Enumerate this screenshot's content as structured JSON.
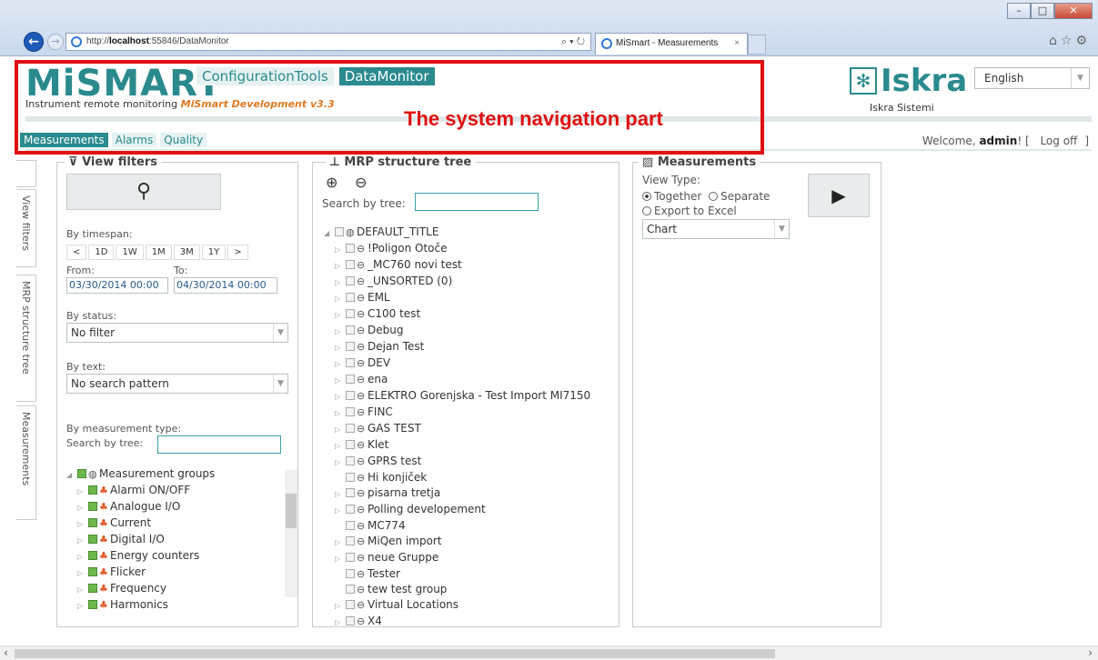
{
  "browser": {
    "url_prefix": "http://",
    "url_host": "localhost",
    "url_rest": ":55846/DataMonitor",
    "tab_title": "MiSmart - Measurements"
  },
  "header": {
    "logo": "MiSMART",
    "subtitle": "Instrument remote monitoring",
    "version": "MiSmart Development v3.3",
    "nav": [
      "ConfigurationTools",
      "DataMonitor"
    ],
    "subnav": [
      "Measurements",
      "Alarms",
      "Quality"
    ],
    "annotation": "The system navigation part",
    "brand": "Iskra",
    "brand_sub": "Iskra Sistemi",
    "language": "English",
    "welcome_prefix": "Welcome,",
    "user": "admin",
    "welcome_mid": "! [",
    "logout": "Log off",
    "welcome_suffix": "]"
  },
  "vtabs": [
    "View filters",
    "MRP structure tree",
    "Measurements"
  ],
  "filters": {
    "title": "View filters",
    "by_timespan": "By timespan:",
    "spans": [
      "<",
      "1D",
      "1W",
      "1M",
      "3M",
      "1Y",
      ">"
    ],
    "from_label": "From:",
    "to_label": "To:",
    "from": "03/30/2014 00:00",
    "to": "04/30/2014 00:00",
    "by_status": "By status:",
    "status": "No filter",
    "by_text": "By text:",
    "text": "No search pattern",
    "by_measurement_type": "By measurement type:",
    "search_by_tree": "Search by tree:",
    "tree_root": "Measurement groups",
    "tree_items": [
      "Alarmi ON/OFF",
      "Analogue I/O",
      "Current",
      "Digital I/O",
      "Energy counters",
      "Flicker",
      "Frequency",
      "Harmonics"
    ]
  },
  "mrp": {
    "title": "MRP structure tree",
    "search_by_tree": "Search by tree:",
    "root": "DEFAULT_TITLE",
    "items": [
      {
        "label": "!Poligon Otoče",
        "exp": true
      },
      {
        "label": "_MC760 novi test",
        "exp": true
      },
      {
        "label": "_UNSORTED (0)",
        "exp": true
      },
      {
        "label": "EML",
        "exp": true
      },
      {
        "label": "C100 test",
        "exp": true
      },
      {
        "label": "Debug",
        "exp": true
      },
      {
        "label": "Dejan Test",
        "exp": true
      },
      {
        "label": "DEV",
        "exp": true
      },
      {
        "label": "ena",
        "exp": true
      },
      {
        "label": "ELEKTRO Gorenjska - Test Import MI7150",
        "exp": true
      },
      {
        "label": "FINC",
        "exp": true
      },
      {
        "label": "GAS TEST",
        "exp": true
      },
      {
        "label": "Klet",
        "exp": true
      },
      {
        "label": "GPRS test",
        "exp": true
      },
      {
        "label": "Hi konjiček",
        "exp": false
      },
      {
        "label": "pisarna tretja",
        "exp": true
      },
      {
        "label": "Polling developement",
        "exp": true
      },
      {
        "label": "MC774",
        "exp": false
      },
      {
        "label": "MiQen import",
        "exp": true
      },
      {
        "label": "neue Gruppe",
        "exp": true
      },
      {
        "label": "Tester",
        "exp": false
      },
      {
        "label": "tew test group",
        "exp": false
      },
      {
        "label": "Virtual Locations",
        "exp": true
      },
      {
        "label": "X4",
        "exp": true
      }
    ]
  },
  "measurements": {
    "title": "Measurements",
    "view_type": "View Type:",
    "together": "Together",
    "separate": "Separate",
    "export": "Export to Excel",
    "chart": "Chart"
  }
}
